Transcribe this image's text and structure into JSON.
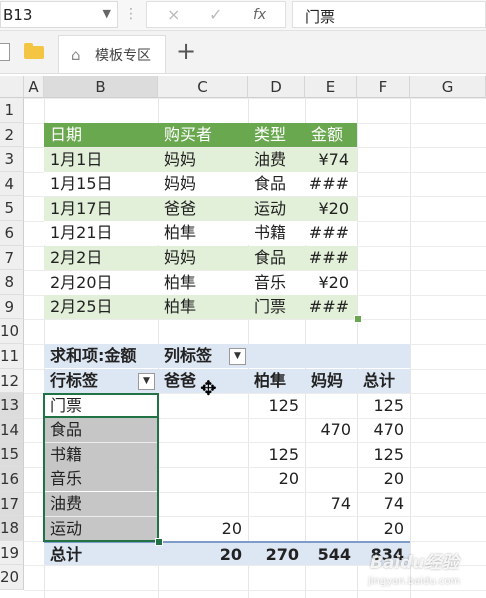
{
  "name_box": "B13",
  "formula": {
    "cancel_icon": "×",
    "confirm_icon": "✓",
    "fx_label": "fx",
    "content": "门票"
  },
  "tabs": [
    {
      "label": "模板专区"
    }
  ],
  "columns": [
    "A",
    "B",
    "C",
    "D",
    "E",
    "F",
    "G"
  ],
  "rows": [
    "1",
    "2",
    "3",
    "4",
    "5",
    "6",
    "7",
    "8",
    "9",
    "10",
    "11",
    "12",
    "13",
    "14",
    "15",
    "16",
    "17",
    "18",
    "19",
    "20"
  ],
  "data_table": {
    "headers": [
      "日期",
      "购买者",
      "类型",
      "金额"
    ],
    "rows": [
      [
        "1月1日",
        "妈妈",
        "油费",
        "¥74"
      ],
      [
        "1月15日",
        "妈妈",
        "食品",
        "###"
      ],
      [
        "1月17日",
        "爸爸",
        "运动",
        "¥20"
      ],
      [
        "1月21日",
        "柏隼",
        "书籍",
        "###"
      ],
      [
        "2月2日",
        "妈妈",
        "食品",
        "###"
      ],
      [
        "2月20日",
        "柏隼",
        "音乐",
        "¥20"
      ],
      [
        "2月25日",
        "柏隼",
        "门票",
        "###"
      ]
    ]
  },
  "pivot": {
    "sum_label": "求和项:金额",
    "col_label": "列标签",
    "row_label": "行标签",
    "col_headers": [
      "爸爸",
      "柏隼",
      "妈妈",
      "总计"
    ],
    "rows": [
      {
        "label": "门票",
        "c": "",
        "d": "125",
        "e": "",
        "f": "125"
      },
      {
        "label": "食品",
        "c": "",
        "d": "",
        "e": "470",
        "f": "470"
      },
      {
        "label": "书籍",
        "c": "",
        "d": "125",
        "e": "",
        "f": "125"
      },
      {
        "label": "音乐",
        "c": "",
        "d": "20",
        "e": "",
        "f": "20"
      },
      {
        "label": "油费",
        "c": "",
        "d": "",
        "e": "74",
        "f": "74"
      },
      {
        "label": "运动",
        "c": "20",
        "d": "",
        "e": "",
        "f": "20"
      }
    ],
    "total": {
      "label": "总计",
      "c": "20",
      "d": "270",
      "e": "544",
      "f": "834"
    }
  },
  "watermark": {
    "text": "Baidu经验",
    "sub": "jingyan.baidu.com"
  }
}
